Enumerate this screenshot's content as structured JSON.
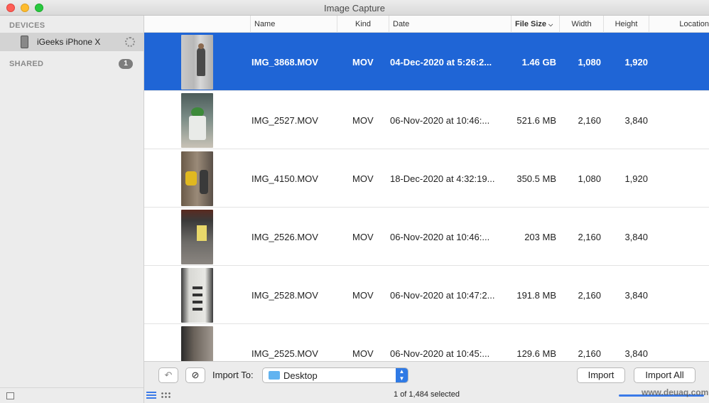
{
  "window": {
    "title": "Image Capture"
  },
  "sidebar": {
    "devices_heading": "DEVICES",
    "device_name": "iGeeks iPhone X",
    "shared_heading": "SHARED",
    "shared_count": "1"
  },
  "columns": [
    "Name",
    "Kind",
    "Date",
    "File Size",
    "Width",
    "Height",
    "Location"
  ],
  "rows": [
    {
      "name": "IMG_3868.MOV",
      "kind": "MOV",
      "date": "04-Dec-2020 at 5:26:2...",
      "size": "1.46 GB",
      "width": "1,080",
      "height": "1,920",
      "selected": true
    },
    {
      "name": "IMG_2527.MOV",
      "kind": "MOV",
      "date": "06-Nov-2020 at 10:46:...",
      "size": "521.6 MB",
      "width": "2,160",
      "height": "3,840"
    },
    {
      "name": "IMG_4150.MOV",
      "kind": "MOV",
      "date": "18-Dec-2020 at 4:32:19...",
      "size": "350.5 MB",
      "width": "1,080",
      "height": "1,920"
    },
    {
      "name": "IMG_2526.MOV",
      "kind": "MOV",
      "date": "06-Nov-2020 at 10:46:...",
      "size": "203 MB",
      "width": "2,160",
      "height": "3,840"
    },
    {
      "name": "IMG_2528.MOV",
      "kind": "MOV",
      "date": "06-Nov-2020 at 10:47:2...",
      "size": "191.8 MB",
      "width": "2,160",
      "height": "3,840"
    },
    {
      "name": "IMG_2525.MOV",
      "kind": "MOV",
      "date": "06-Nov-2020 at 10:45:...",
      "size": "129.6 MB",
      "width": "2,160",
      "height": "3,840"
    }
  ],
  "bottom": {
    "import_to_label": "Import To:",
    "destination": "Desktop",
    "import_label": "Import",
    "import_all_label": "Import All"
  },
  "status": {
    "text": "1 of 1,484 selected"
  },
  "watermark": "www.deuaq.com",
  "colors": {
    "selection": "#1f65d6",
    "accent": "#3b7ae8"
  }
}
